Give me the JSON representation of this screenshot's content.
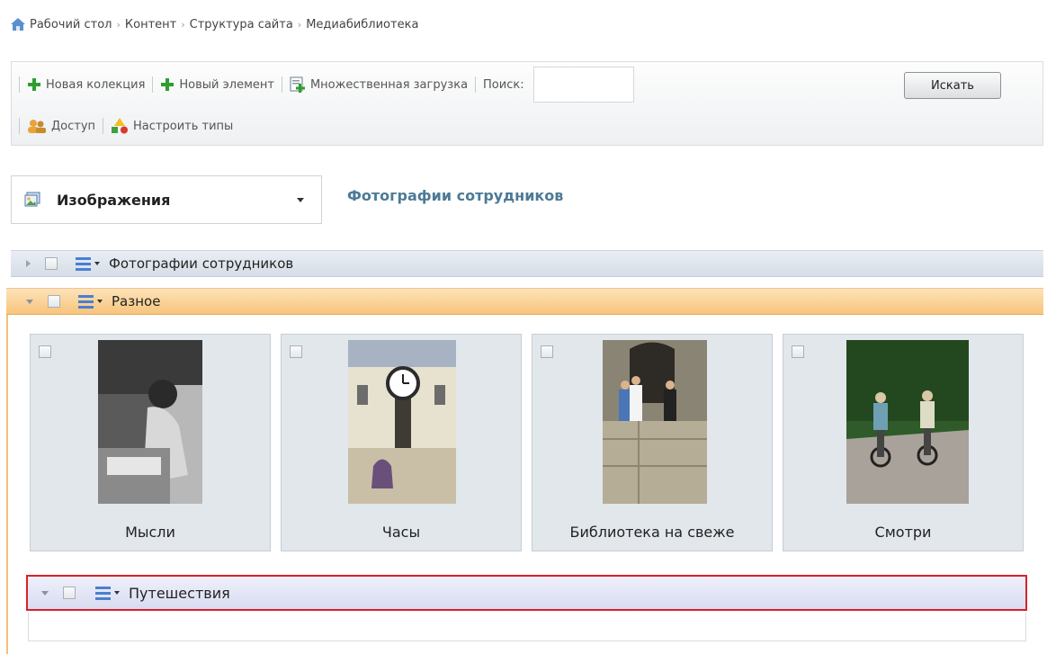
{
  "breadcrumb": {
    "items": [
      "Рабочий стол",
      "Контент",
      "Структура сайта",
      "Медиабиблиотека"
    ],
    "separator": "›"
  },
  "toolbar": {
    "new_collection": "Новая колекция",
    "new_item": "Новый элемент",
    "multi_upload": "Множественная загрузка",
    "search_label": "Поиск:",
    "search_value": "",
    "search_button": "Искать",
    "access": "Доступ",
    "configure_types": "Настроить типы"
  },
  "selector": {
    "value": "Изображения",
    "collection_title": "Фотографии сотрудников"
  },
  "categories": {
    "staff": {
      "label": "Фотографии сотрудников",
      "state": "collapsed"
    },
    "misc": {
      "label": "Разное",
      "state": "expanded"
    },
    "travel": {
      "label": "Путешествия",
      "state": "expanded",
      "highlighted": true
    }
  },
  "thumbnails": [
    {
      "caption": "Мысли"
    },
    {
      "caption": "Часы"
    },
    {
      "caption": "Библиотека на свеже"
    },
    {
      "caption": "Смотри"
    }
  ],
  "colors": {
    "accent_title": "#4c7a96",
    "expanded_row": "#f7c47c",
    "highlight_border": "#d8212b",
    "add_icon": "#2e9e2e",
    "list_icon": "#4a7fd3"
  }
}
